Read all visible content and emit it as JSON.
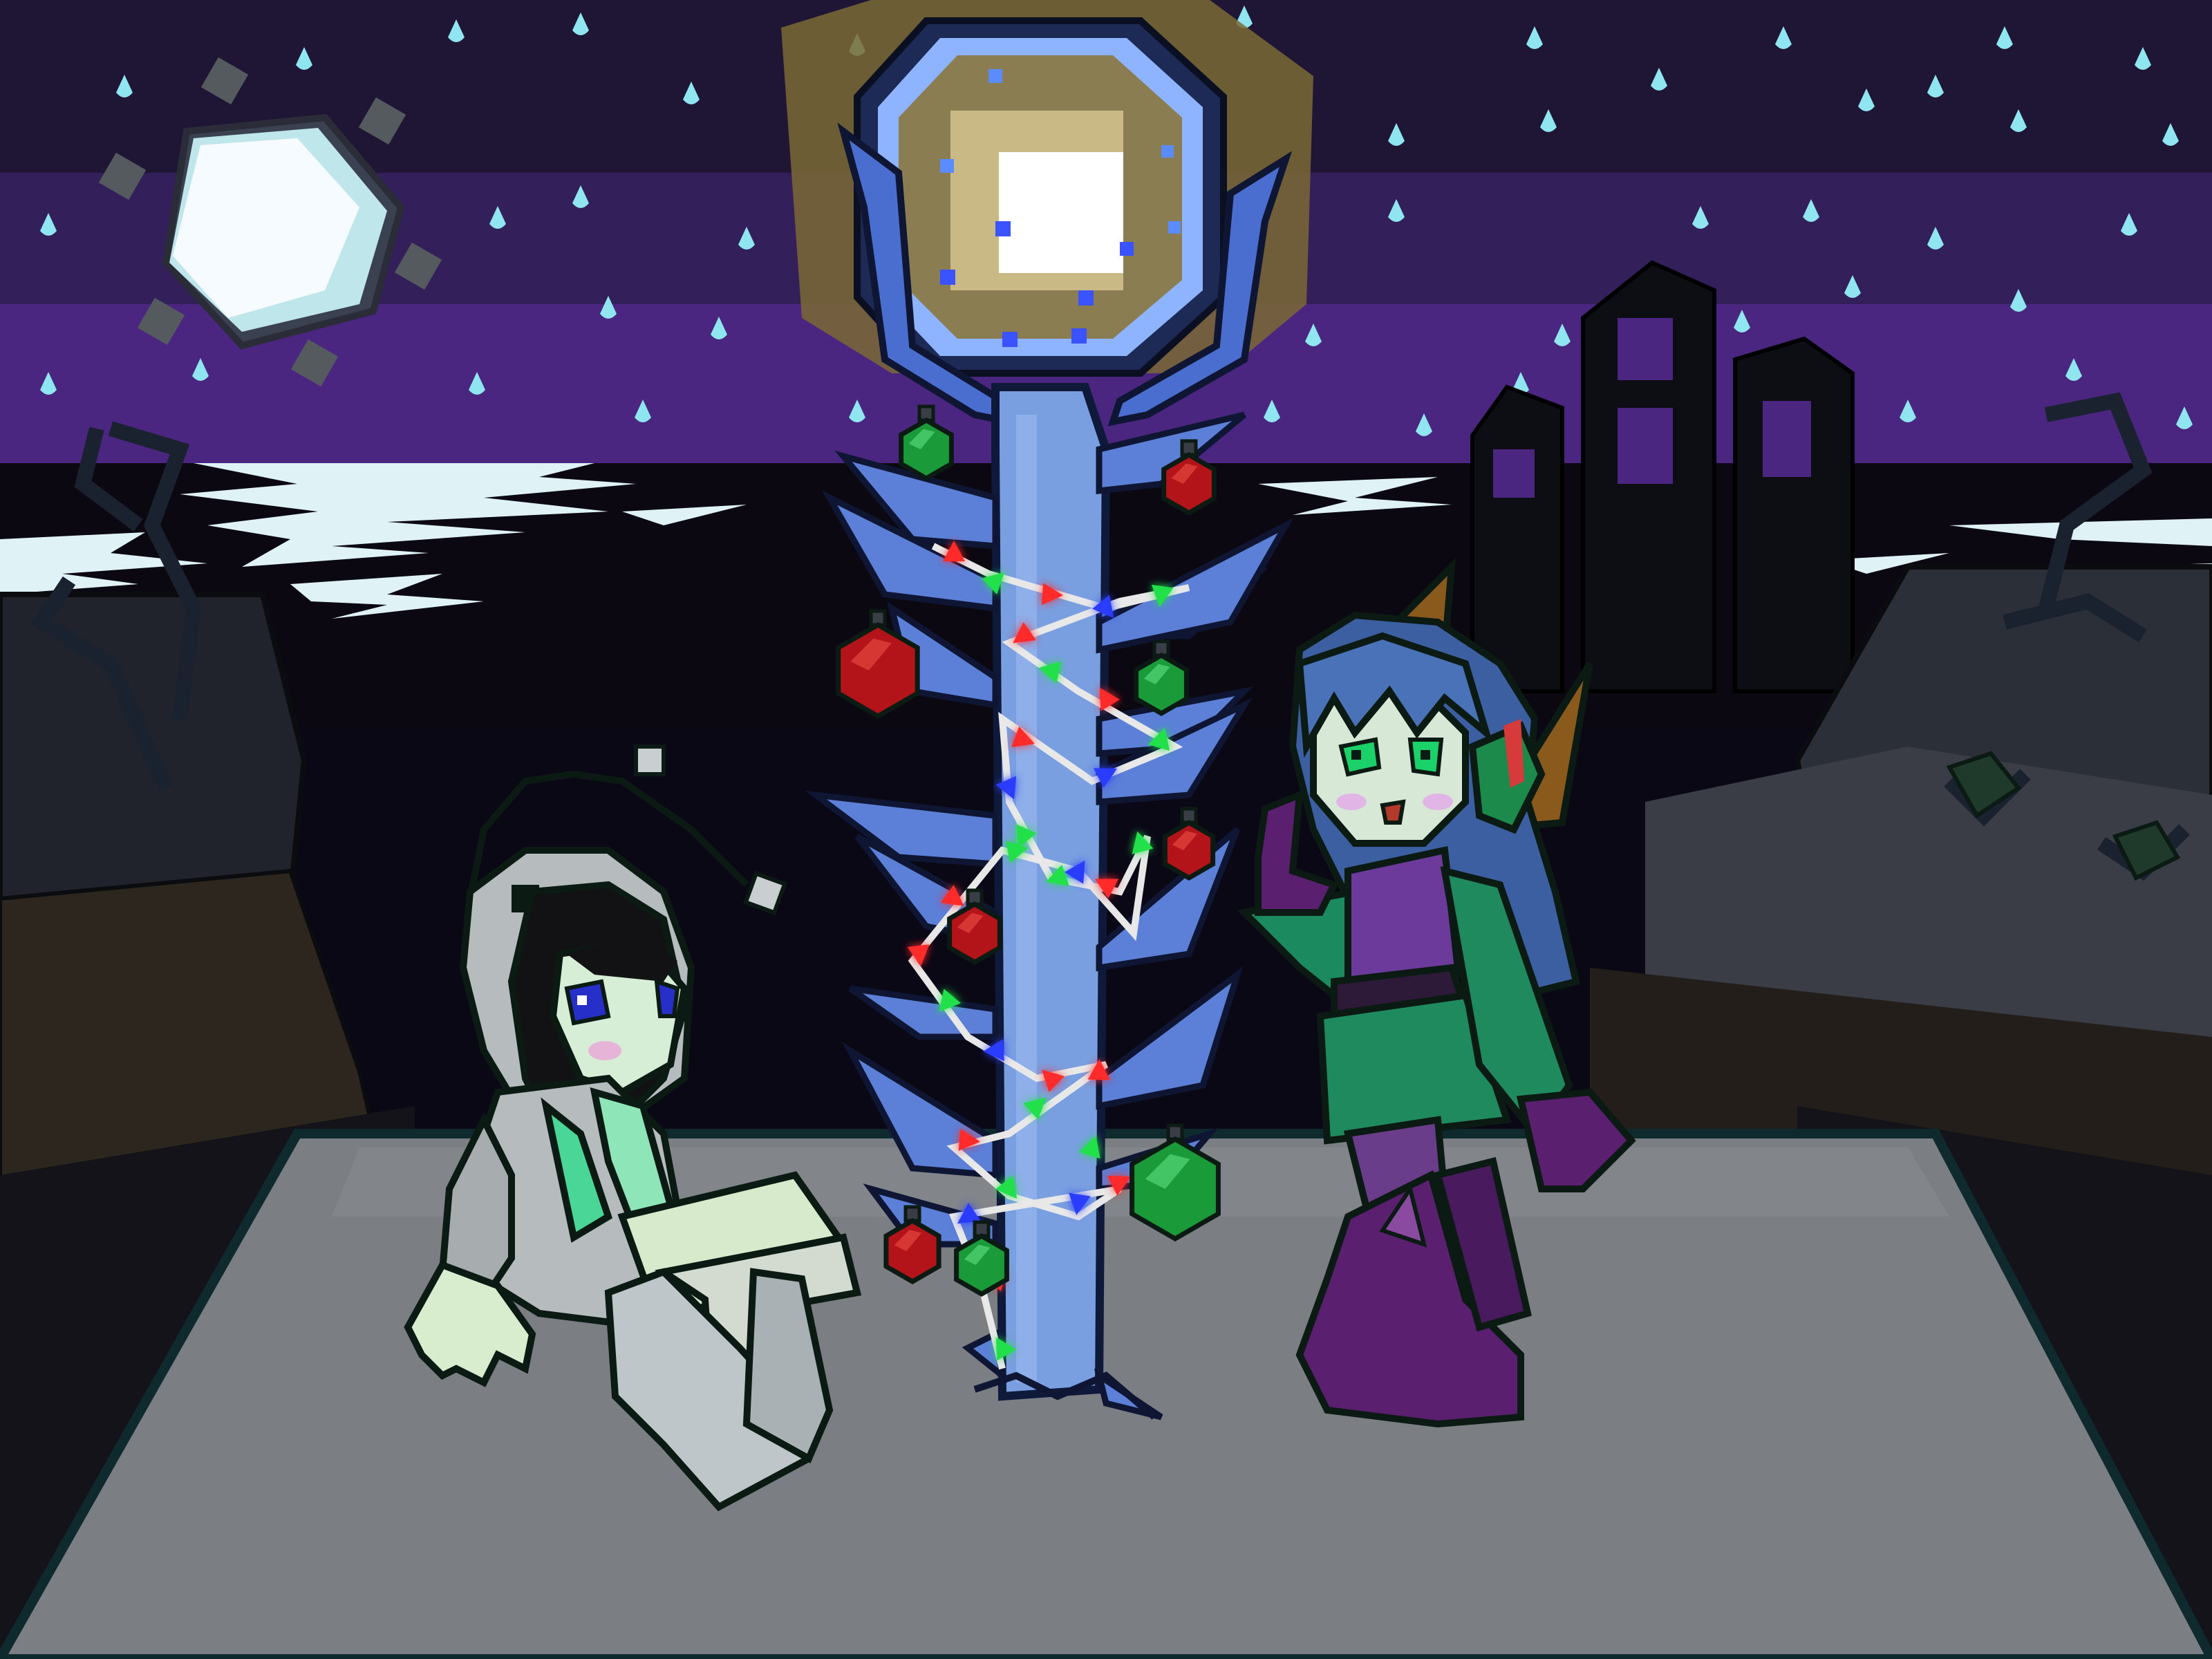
{
  "scene": {
    "kind": "illustration",
    "palette": {
      "sky_band_1": "#1f1636",
      "sky_band_2": "#3a1f63",
      "sky_band_3": "#51288a",
      "sea": "#0a0712",
      "sea_highlight": "#cfe8ee",
      "cliff_dark": "#1a1a22",
      "cliff_mid": "#3a3b45",
      "cliff_brown": "#2b221e",
      "platform": "#7a7e82",
      "platform_edge": "#132628",
      "moon": "#f4fbff",
      "moon_shade": "#9fd6e0",
      "lamp_glow": "#7b6a34",
      "lamp_core": "#ffffff",
      "lamp_pole": "#7a9fe0",
      "lamp_pole_outline": "#1c2a55",
      "ornament_green": "#1b9a3a",
      "ornament_red": "#b3141a",
      "light_red": "#ff2a2a",
      "light_green": "#22e04a",
      "light_blue": "#2a3dff",
      "star": "#8fe6f0",
      "outline": "#0b1a12"
    },
    "subjects": [
      {
        "name": "hooded-girl",
        "hoodie": "#b7bcbf",
        "hair": "#111111",
        "eyes": "#2630c8",
        "shirt": "#8ee6b8"
      },
      {
        "name": "blue-haired-girl",
        "hair": "#3b5fa0",
        "eyes": "#1ad16a",
        "top": "#6b3a9a",
        "skirt": "#1f8a5e",
        "boots": "#5a1f6e",
        "horns": "#8a5a1c"
      }
    ],
    "icons": [
      "moon-icon",
      "star-icon",
      "street-lamp-icon",
      "ornament-icon",
      "building-silhouette-icon"
    ]
  }
}
